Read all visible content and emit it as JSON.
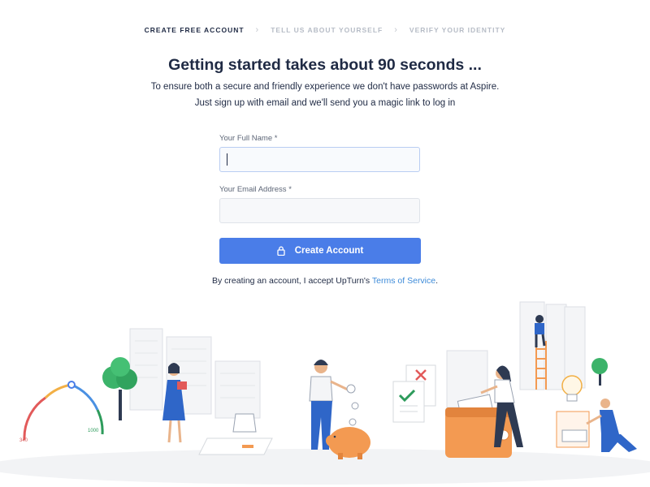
{
  "stepper": {
    "steps": [
      "CREATE FREE ACCOUNT",
      "TELL US ABOUT YOURSELF",
      "VERIFY YOUR IDENTITY"
    ]
  },
  "header": {
    "title": "Getting started takes about 90 seconds ...",
    "subtitle_line1": "To ensure both a secure and friendly experience we don't have passwords at Aspire.",
    "subtitle_line2": "Just sign up with email and we'll send you a magic link to log in"
  },
  "form": {
    "name_label": "Your Full Name *",
    "name_value": "",
    "email_label": "Your Email Address *",
    "email_value": "",
    "submit_label": "Create Account"
  },
  "terms": {
    "prefix": "By creating an account, I accept UpTurn's ",
    "link": "Terms of Service",
    "suffix": "."
  },
  "illustration": {
    "gauge_min": "340",
    "gauge_max": "1000"
  },
  "colors": {
    "accent": "#4a7de8",
    "text": "#1f2a44",
    "link": "#3d8bd9",
    "orange": "#f39a52",
    "green": "#2d9b5b",
    "blue_figure": "#2f66c8"
  }
}
